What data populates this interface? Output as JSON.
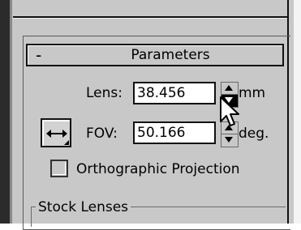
{
  "parameters": {
    "header_title": "Parameters",
    "collapse_symbol": "-",
    "lens": {
      "label": "Lens:",
      "value": "38.456",
      "unit": "mm"
    },
    "fov": {
      "label": "FOV:",
      "value": "50.166",
      "unit": "deg.",
      "direction_button_icon": "horizontal-double-arrow-icon"
    },
    "orthographic": {
      "label": "Orthographic Projection",
      "checked": false
    },
    "stock_lenses": {
      "title": "Stock Lenses"
    }
  },
  "colors": {
    "panel_bg": "#c8c8c8",
    "text": "#000000",
    "input_bg": "#ffffff"
  }
}
